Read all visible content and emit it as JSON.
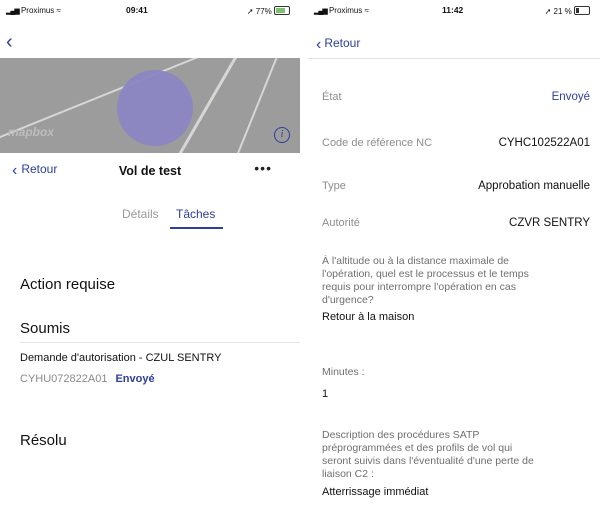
{
  "left": {
    "status": {
      "carrier": "Proximus",
      "time": "09:41",
      "battery": "77%"
    },
    "map": {
      "logo": "mapbox",
      "info": "i"
    },
    "navbar": {
      "back": "Retour",
      "title": "Vol de test",
      "more": "•••"
    },
    "tabs": [
      {
        "label": "Détails"
      },
      {
        "label": "Tâches"
      }
    ],
    "sections": {
      "action": "Action requise",
      "soumis": "Soumis",
      "resolu": "Résolu"
    },
    "request": {
      "title": "Demande d'autorisation  -  CZUL SENTRY",
      "reference": "CYHU072822A01",
      "status": "Envoyé"
    }
  },
  "right": {
    "status": {
      "carrier": "Proximus",
      "time": "11:42",
      "battery": "21 %"
    },
    "back": "Retour",
    "rows": [
      {
        "label": "État",
        "value": "Envoyé"
      },
      {
        "label": "Code de référence NC",
        "value": "CYHC102522A01"
      },
      {
        "label": "Type",
        "value": "Approbation manuelle"
      },
      {
        "label": "Autorité",
        "value": "CZVR SENTRY"
      }
    ],
    "qa": [
      {
        "q_lines": [
          "À l'altitude ou à la distance maximale de",
          "l'opération, quel est le processus et le temps",
          "requis pour interrompre l'opération en cas",
          "d'urgence?"
        ],
        "a": "Retour à la maison"
      },
      {
        "q_lines": [
          "Minutes :"
        ],
        "a": "1"
      },
      {
        "q_lines": [
          "Description des procédures SATP",
          "préprogrammées et des profils de vol qui",
          "seront suivis dans l'éventualité d'une perte de",
          "liaison C2 :"
        ],
        "a": "Atterrissage immédiat"
      }
    ]
  },
  "colors": {
    "accent": "#2d3e9c",
    "map_bg": "#9c9c9c",
    "circle": "#8b86c2"
  }
}
